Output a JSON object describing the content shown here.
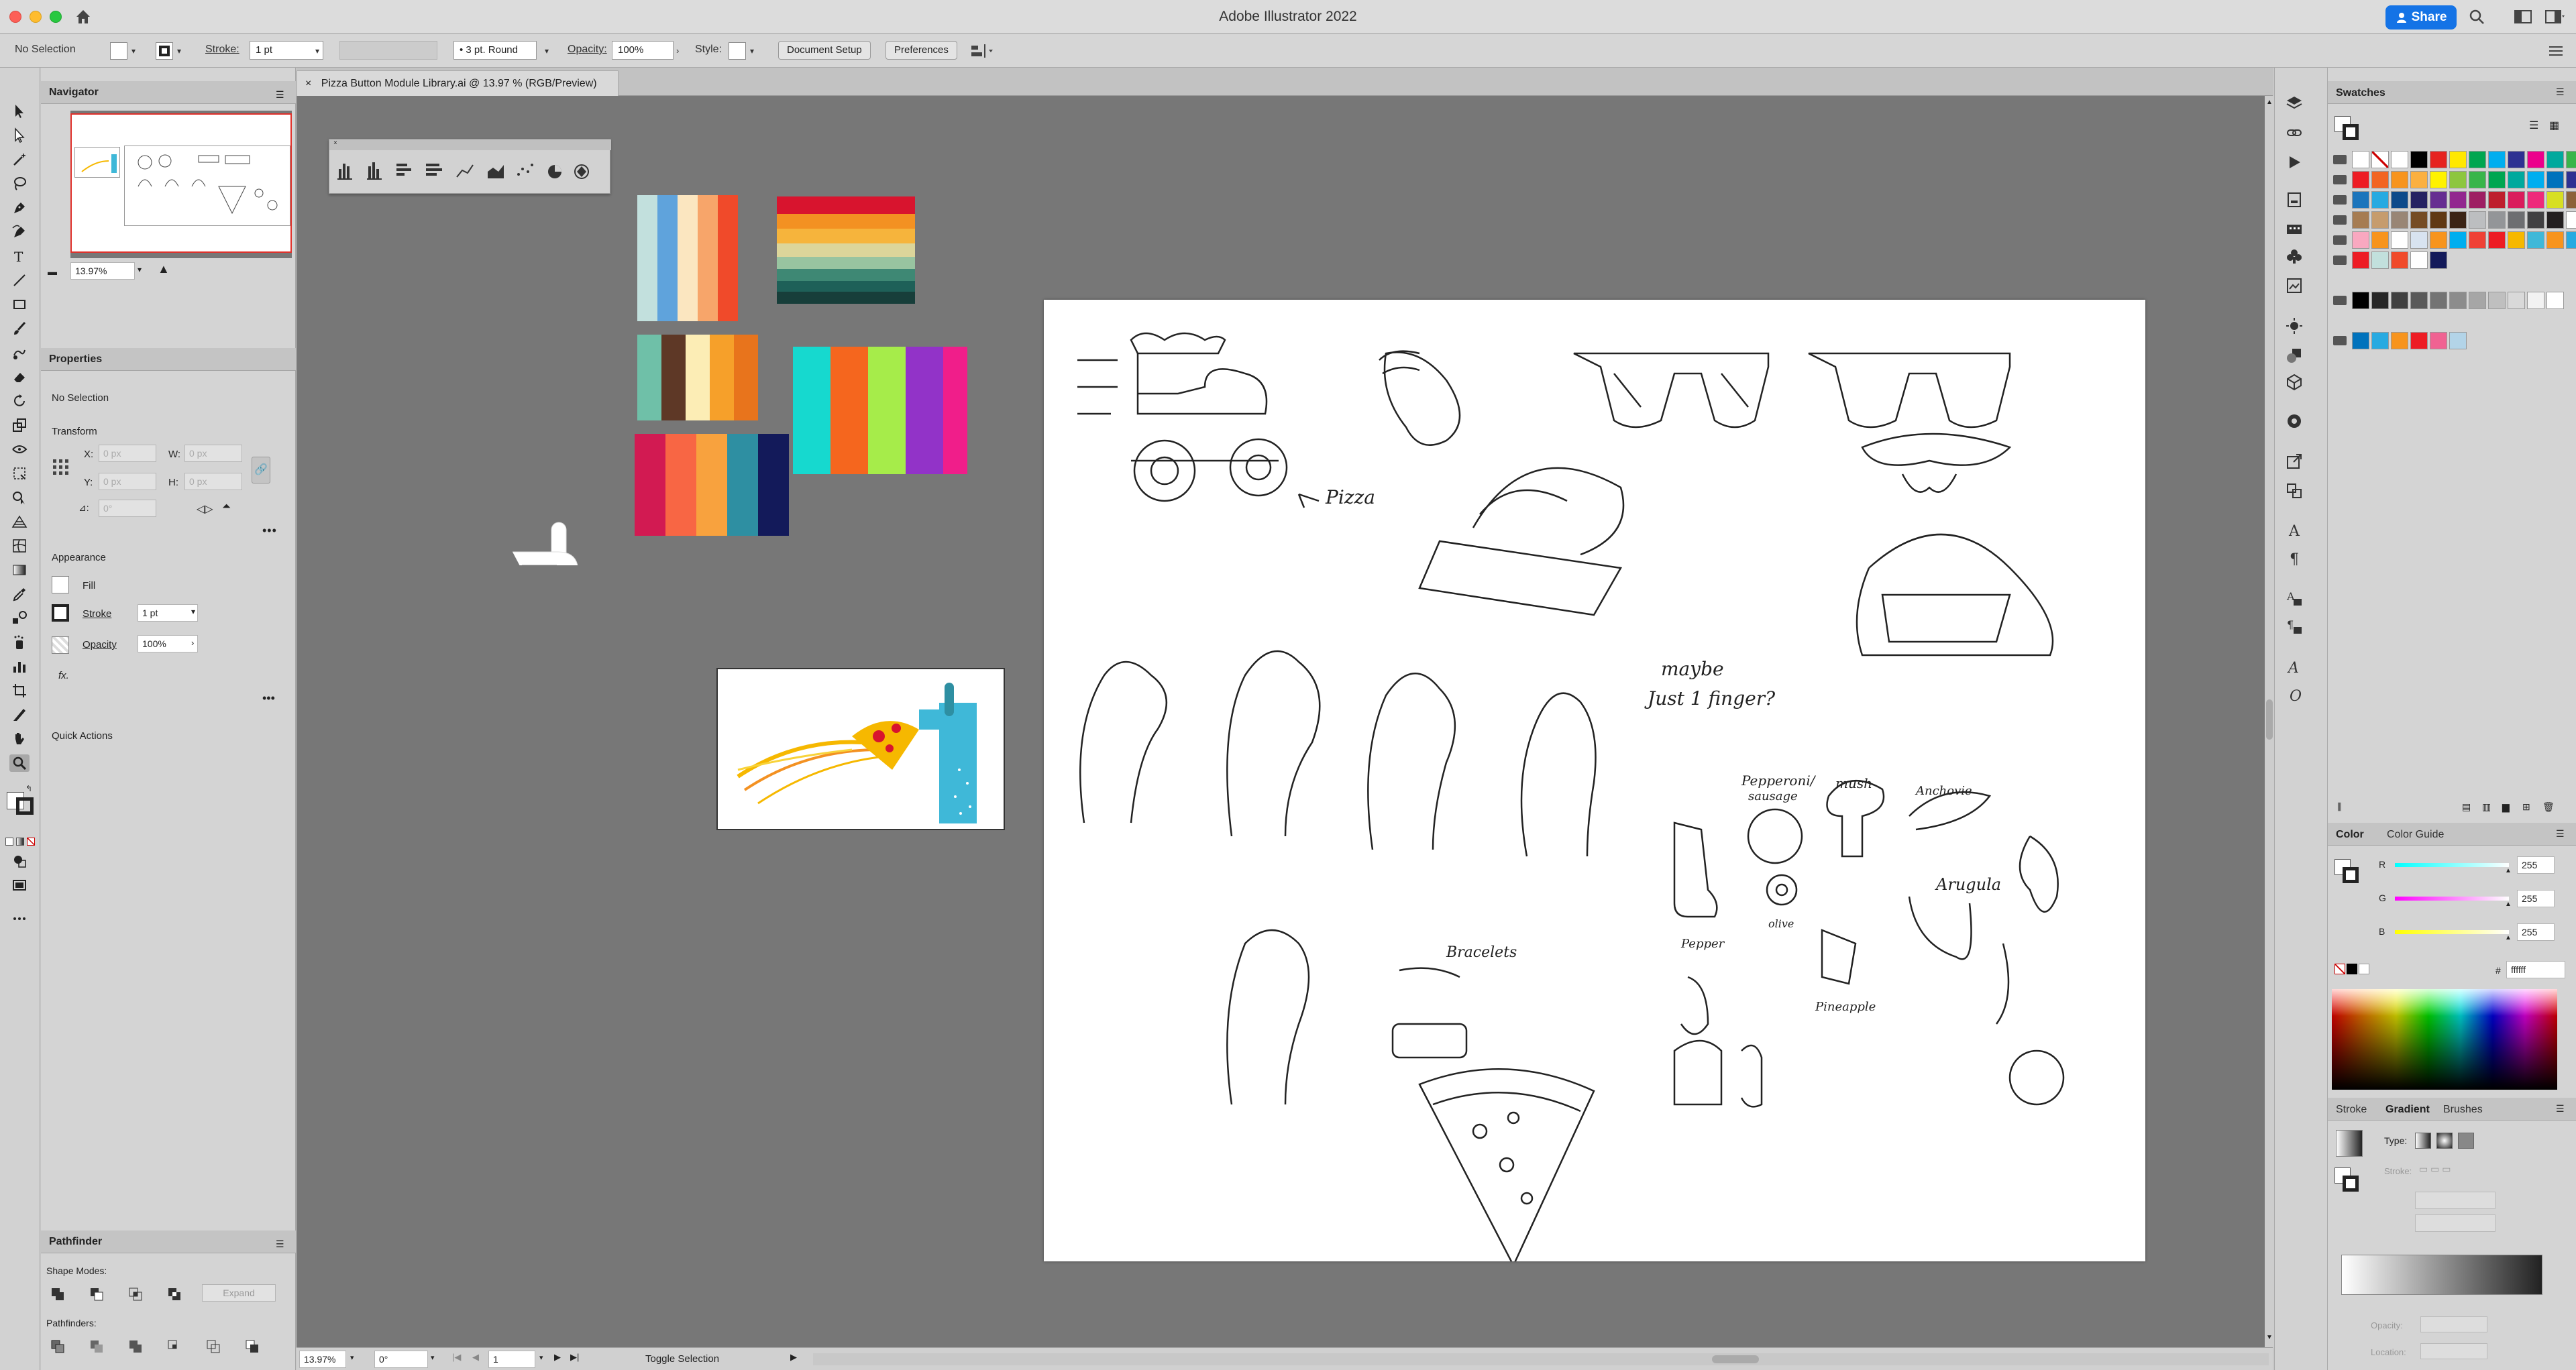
{
  "window": {
    "title": "Adobe Illustrator 2022",
    "share_label": "Share"
  },
  "control_bar": {
    "selection": "No Selection",
    "stroke_label": "Stroke:",
    "stroke_value": "1 pt",
    "brush_value": "3 pt. Round",
    "opacity_label": "Opacity:",
    "opacity_value": "100%",
    "style_label": "Style:",
    "document_setup": "Document Setup",
    "preferences": "Preferences"
  },
  "document": {
    "tab_title": "Pizza Button Module Library.ai @ 13.97 % (RGB/Preview)"
  },
  "navigator": {
    "title": "Navigator",
    "zoom": "13.97%"
  },
  "properties": {
    "title": "Properties",
    "selection": "No Selection",
    "transform": "Transform",
    "x": "X:",
    "y": "Y:",
    "w": "W:",
    "h": "H:",
    "x_val": "0 px",
    "y_val": "0 px",
    "w_val": "0 px",
    "h_val": "0 px",
    "angle": "0°",
    "appearance": "Appearance",
    "fill": "Fill",
    "stroke": "Stroke",
    "stroke_value": "1 pt",
    "opacity": "Opacity",
    "opacity_value": "100%",
    "fx": "fx.",
    "quick_actions": "Quick Actions"
  },
  "pathfinder": {
    "title": "Pathfinder",
    "shape_modes": "Shape Modes:",
    "pathfinders": "Pathfinders:",
    "expand": "Expand"
  },
  "status": {
    "zoom": "13.97%",
    "rotate": "0°",
    "artboard": "1",
    "tool": "Toggle Selection"
  },
  "swatches": {
    "title": "Swatches"
  },
  "color": {
    "tab_color": "Color",
    "tab_guide": "Color Guide",
    "r_label": "R",
    "g_label": "G",
    "b_label": "B",
    "r": "255",
    "g": "255",
    "b": "255",
    "hash": "#",
    "hex": "ffffff"
  },
  "gradient": {
    "tab_stroke": "Stroke",
    "tab_gradient": "Gradient",
    "tab_brushes": "Brushes",
    "type_label": "Type:",
    "stroke_label": "Stroke:",
    "opacity_label": "Opacity:",
    "location_label": "Location:"
  },
  "sketch_labels": {
    "pizza": "Pizza",
    "maybe": "maybe",
    "just_one": "Just 1 finger?",
    "bracelets": "Bracelets",
    "pepperoni": "Pepperoni/",
    "sausage": "sausage",
    "mush": "mush",
    "anchovie": "Anchovie",
    "pepper": "Pepper",
    "olive": "olive",
    "pineapple": "Pineapple",
    "arugula": "Arugula"
  },
  "colors": {
    "accent": "#1473e6",
    "canvas": "#777777",
    "pizza_yellow": "#f6b800",
    "hand_blue": "#3fb8d8"
  }
}
